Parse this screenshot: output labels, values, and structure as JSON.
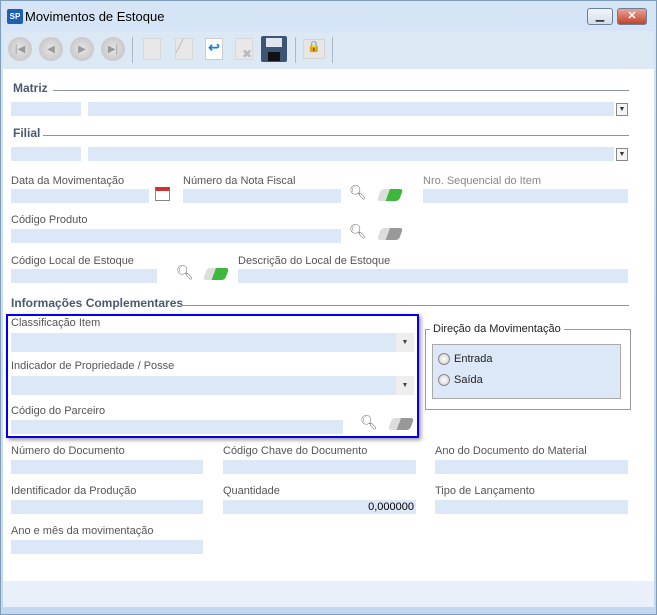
{
  "window": {
    "title": "Movimentos de Estoque",
    "logo": "SP",
    "minimize_icon": "minimize-icon",
    "close_icon": "close-icon"
  },
  "toolbar": {
    "icons": [
      "first-record-icon",
      "previous-record-icon",
      "next-record-icon",
      "last-record-icon",
      "new-icon",
      "edit-icon",
      "undo-icon",
      "delete-icon",
      "save-icon",
      "lock-icon"
    ]
  },
  "sections": {
    "matriz": "Matriz",
    "filial": "Filial",
    "info": "Informações Complementares"
  },
  "fields": {
    "data_mov": "Data da Movimentação",
    "nota_fiscal": "Número da Nota Fiscal",
    "nro_seq": "Nro. Sequencial do Item",
    "cod_produto": "Código Produto",
    "cod_local": "Código Local de Estoque",
    "desc_local": "Descrição do Local de Estoque",
    "classificacao": "Classificação Item",
    "indicador": "Indicador de Propriedade / Posse",
    "cod_parceiro": "Código do Parceiro",
    "num_doc": "Número do Documento",
    "cod_chave": "Código Chave do Documento",
    "ano_doc": "Ano do Documento do Material",
    "ident_prod": "Identificador da Produção",
    "quantidade": "Quantidade",
    "quantidade_value": "0,000000",
    "tipo_lanc": "Tipo de Lançamento",
    "ano_mes": "Ano e mês da movimentação"
  },
  "direcao": {
    "title": "Direção da Movimentação",
    "options": [
      "Entrada",
      "Saída"
    ]
  },
  "colors": {
    "highlight": "#0000ee",
    "field": "#dce8f8",
    "eraser_active": "#3cb83c"
  }
}
